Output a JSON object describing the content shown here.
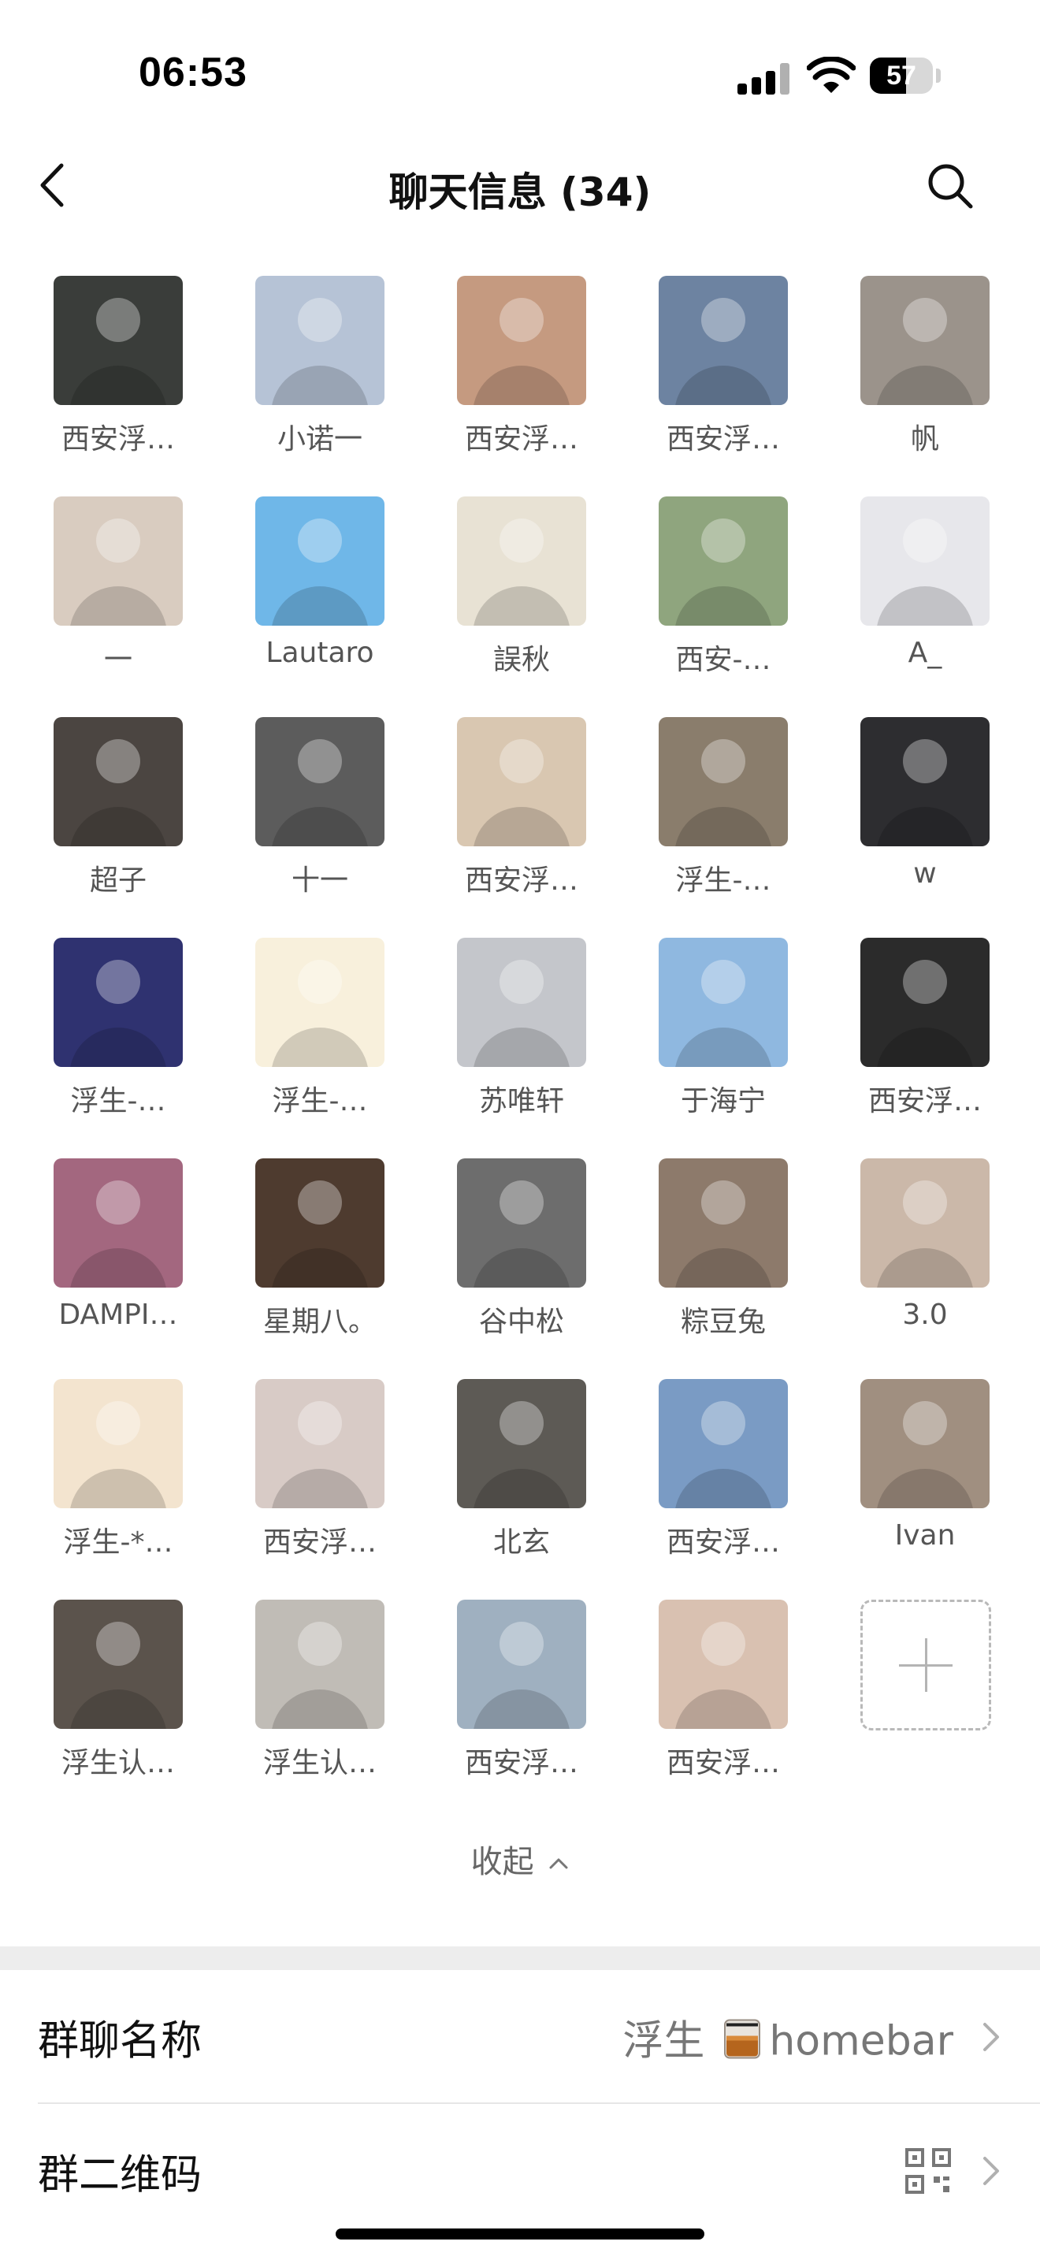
{
  "status_bar": {
    "time": "06:53",
    "battery_level": "57",
    "battery_percent": 57
  },
  "header": {
    "title": "聊天信息 (34)",
    "back_icon": "chevron-left-icon",
    "search_icon": "search-icon"
  },
  "members": [
    {
      "name": "西安浮…",
      "color": "#3a3d3a"
    },
    {
      "name": "小诺一",
      "color": "#b6c3d6"
    },
    {
      "name": "西安浮…",
      "color": "#c59a80"
    },
    {
      "name": "西安浮…",
      "color": "#6d83a1"
    },
    {
      "name": "帆",
      "color": "#9b938b"
    },
    {
      "name": "一",
      "color": "#d9ccc0"
    },
    {
      "name": "Lautaro",
      "color": "#6fb7e8"
    },
    {
      "name": "誤秋",
      "color": "#e8e2d4"
    },
    {
      "name": "西安-…",
      "color": "#8fa57e"
    },
    {
      "name": "A_",
      "color": "#e7e7eb"
    },
    {
      "name": "超子",
      "color": "#4b4541"
    },
    {
      "name": "十一",
      "color": "#5c5c5c"
    },
    {
      "name": "西安浮…",
      "color": "#d9c7b1"
    },
    {
      "name": "浮生-…",
      "color": "#8a7d6c"
    },
    {
      "name": "w",
      "color": "#2d2d30"
    },
    {
      "name": "浮生-…",
      "color": "#2f3270"
    },
    {
      "name": "浮生-…",
      "color": "#f8f0dc"
    },
    {
      "name": "苏唯轩",
      "color": "#c4c6cb"
    },
    {
      "name": "于海宁",
      "color": "#8fb8e0"
    },
    {
      "name": "西安浮…",
      "color": "#2b2b2b"
    },
    {
      "name": "DAMPI…",
      "color": "#a3677f"
    },
    {
      "name": "星期八。",
      "color": "#4e3b2f"
    },
    {
      "name": "谷中松",
      "color": "#6d6d6d"
    },
    {
      "name": "粽豆兔",
      "color": "#8d7a6b"
    },
    {
      "name": "3.0",
      "color": "#cbb8a9"
    },
    {
      "name": "浮生-*…",
      "color": "#f3e4cf"
    },
    {
      "name": "西安浮…",
      "color": "#d8cbc6"
    },
    {
      "name": "北玄",
      "color": "#5d5a55"
    },
    {
      "name": "西安浮…",
      "color": "#7a9bc4"
    },
    {
      "name": "Ivan",
      "color": "#a08f80"
    },
    {
      "name": "浮生认…",
      "color": "#5b534c"
    },
    {
      "name": "浮生认…",
      "color": "#c0bcb6"
    },
    {
      "name": "西安浮…",
      "color": "#9fb0c0"
    },
    {
      "name": "西安浮…",
      "color": "#d9c1b1"
    }
  ],
  "add_member_icon": "plus-icon",
  "collapse": {
    "label": "收起",
    "icon": "chevron-up-icon"
  },
  "settings": {
    "group_name": {
      "label": "群聊名称",
      "value_prefix": "浮生",
      "value_suffix": "homebar",
      "emoji_icon": "whiskey-glass-icon"
    },
    "qr_code": {
      "label": "群二维码",
      "icon": "qr-code-icon"
    }
  }
}
